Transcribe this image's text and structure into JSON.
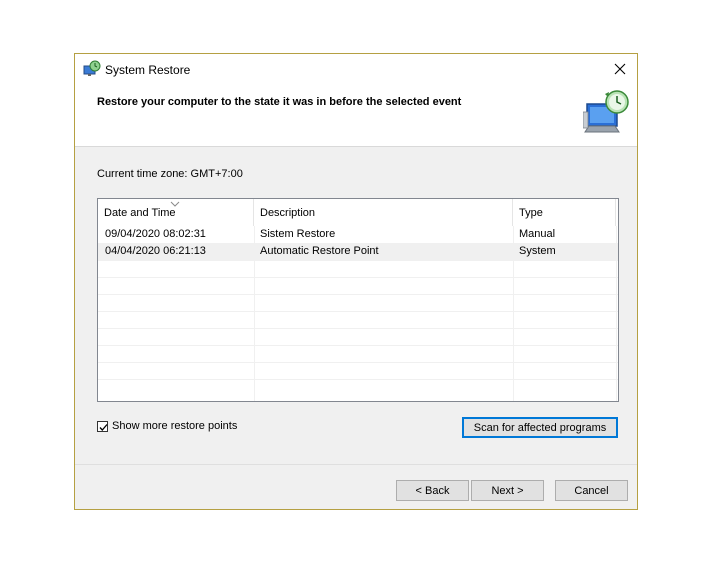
{
  "window": {
    "title": "System Restore",
    "header": "Restore your computer to the state it was in before the selected event"
  },
  "timezone_label": "Current time zone: GMT+7:00",
  "table": {
    "columns": [
      "Date and Time",
      "Description",
      "Type"
    ],
    "rows": [
      {
        "date": "09/04/2020 08:02:31",
        "description": "Sistem Restore",
        "type": "Manual"
      },
      {
        "date": "04/04/2020 06:21:13",
        "description": "Automatic Restore Point",
        "type": "System"
      }
    ]
  },
  "show_more": {
    "label": "Show more restore points",
    "checked": true
  },
  "buttons": {
    "scan": "Scan for affected programs",
    "back": "< Back",
    "next": "Next >",
    "cancel": "Cancel"
  },
  "colors": {
    "focus_border": "#0078d7",
    "window_border": "#b5a042",
    "dialog_bg": "#f0f0f0"
  }
}
